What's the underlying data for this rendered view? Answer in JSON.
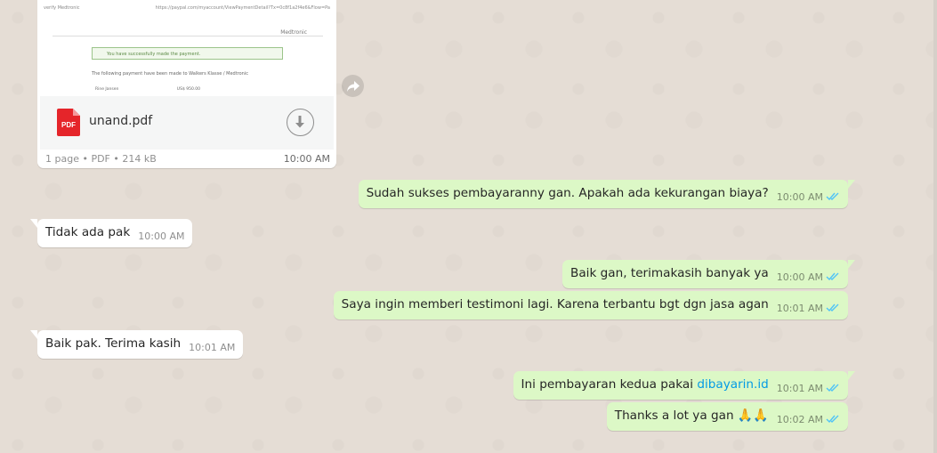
{
  "document": {
    "preview": {
      "header_left": "verify Medtronic",
      "header_right": "https://paypal.com/myaccount/ViewPaymentDetail?Tx=0c8f1a2f4e6&Flow=Pa",
      "brand": "Medtronic",
      "alert": "You have successfully made the payment.",
      "line": "The following payment have been made to Walkers Klasse / Medtronic",
      "row_label": "Rine Jansen",
      "row_amount": "US$ 950.00"
    },
    "icon_label": "PDF",
    "file_name": "unand.pdf",
    "info": "1 page • PDF • 214 kB",
    "time": "10:00 AM"
  },
  "messages": [
    {
      "text": "Sudah sukses pembayaranny gan. Apakah ada kekurangan biaya?",
      "time": "10:00 AM",
      "direction": "out"
    },
    {
      "text": "Tidak ada pak",
      "time": "10:00 AM",
      "direction": "in"
    },
    {
      "text": "Baik gan, terimakasih banyak ya",
      "time": "10:00 AM",
      "direction": "out"
    },
    {
      "text": "Saya ingin memberi testimoni lagi. Karena terbantu bgt dgn jasa agan",
      "time": "10:01 AM",
      "direction": "out"
    },
    {
      "text": "Baik pak. Terima kasih",
      "time": "10:01 AM",
      "direction": "in"
    },
    {
      "text": "Ini pembayaran kedua pakai ",
      "link": "dibayarin.id",
      "time": "10:01 AM",
      "direction": "out"
    },
    {
      "text": "Thanks a lot ya gan ",
      "emoji": "🙏🙏",
      "time": "10:02 AM",
      "direction": "out"
    }
  ],
  "colors": {
    "background": "#e5ddd5",
    "incoming_bubble": "#ffffff",
    "outgoing_bubble": "#dcf8c6",
    "read_ticks": "#4fc3f7",
    "link": "#039be5",
    "pdf_red": "#e5252a"
  },
  "icons": {
    "forward": "forward-arrow-icon",
    "download": "download-arrow-icon",
    "file": "pdf-file-icon",
    "status": "double-check-read-icon"
  }
}
